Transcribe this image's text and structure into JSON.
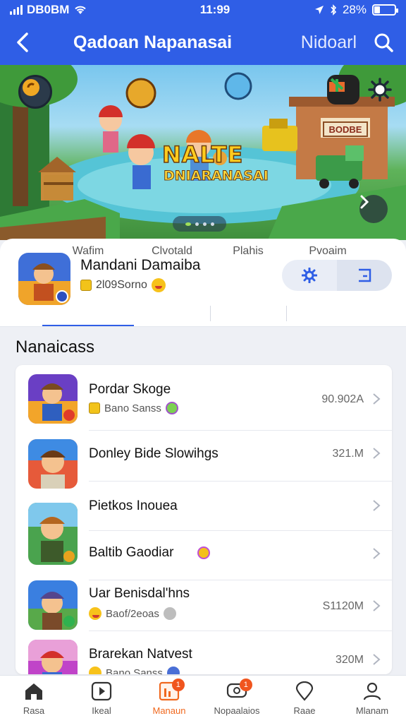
{
  "status_bar": {
    "carrier": "DB0BM",
    "time": "11:99",
    "battery": "28%",
    "battery_level": 0.28
  },
  "nav": {
    "title": "Qadoan Napanasai",
    "action": "Nidoarl"
  },
  "banner": {
    "title_line1": "NALTE",
    "title_line2": "DNIARANASAI",
    "shop_sign": "BODBE",
    "slide_count": 4,
    "active_slide": 0
  },
  "app": {
    "name": "Mandani Damaiba",
    "meta": "2l09Sorno",
    "tabs": [
      {
        "label": "Wafim",
        "active": true
      },
      {
        "label": "Clvotald",
        "active": false
      },
      {
        "label": "Plahis",
        "active": false
      },
      {
        "label": "Pvoaim",
        "active": false
      }
    ]
  },
  "section": {
    "title": "Nanaicass"
  },
  "list": [
    {
      "title": "Pordar Skoge",
      "subtitle": "Bano Sanss",
      "size": "90.902A"
    },
    {
      "title": "Donley Bide Slowihgs",
      "subtitle": "",
      "size": "321.M"
    },
    {
      "title": "Pietkos Inouea",
      "subtitle": "",
      "size": ""
    },
    {
      "title": "Baltib Gaodiar",
      "subtitle": "",
      "size": ""
    },
    {
      "title": "Uar Benisdal'hns",
      "subtitle": "Baof/2eoas",
      "size": "S1120M"
    },
    {
      "title": "Brarekan Natvest",
      "subtitle": "Bano Sanss",
      "size": "320M"
    }
  ],
  "bottom_nav": [
    {
      "label": "Rasa",
      "icon": "home-icon",
      "active": false,
      "badge": ""
    },
    {
      "label": "Ikeal",
      "icon": "play-icon",
      "active": false,
      "badge": ""
    },
    {
      "label": "Manaun",
      "icon": "chart-icon",
      "active": true,
      "badge": "1"
    },
    {
      "label": "Nopaalaios",
      "icon": "chat-icon",
      "active": false,
      "badge": "1"
    },
    {
      "label": "Raae",
      "icon": "location-icon",
      "active": false,
      "badge": ""
    },
    {
      "label": "Mlanam",
      "icon": "user-icon",
      "active": false,
      "badge": ""
    }
  ],
  "colors": {
    "primary": "#2f5ee6",
    "accent": "#f0681e",
    "background": "#eef0f5"
  }
}
